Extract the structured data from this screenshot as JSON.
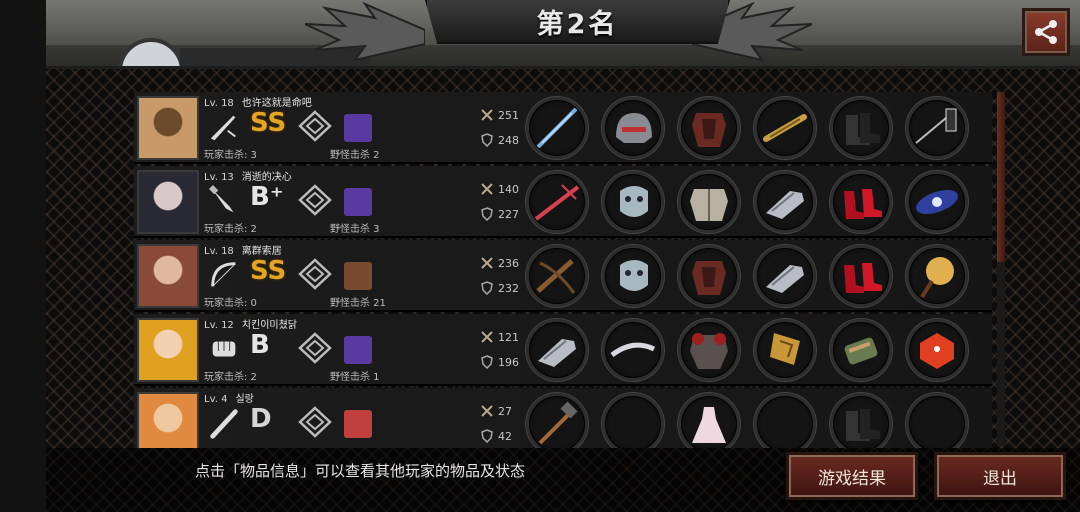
{
  "header": {
    "rank_title": "第2名"
  },
  "players": [
    {
      "level": "Lv. 18",
      "name": "也许这就是命吧",
      "weapon_icon": "dagger-icon",
      "grade": "SS",
      "player_kills": "玩家击杀: 3",
      "monster_kills": "野怪击杀 2",
      "attack": "251",
      "defense": "248",
      "items": [
        "sword-icon",
        "helmet-icon",
        "armor-icon",
        "arm-guard-icon",
        "boots-icon",
        "spear-icon"
      ]
    },
    {
      "level": "Lv. 13",
      "name": "消逝的决心",
      "weapon_icon": "knife-icon",
      "grade": "B⁺",
      "player_kills": "玩家击杀: 2",
      "monster_kills": "野怪击杀 3",
      "attack": "140",
      "defense": "227",
      "items": [
        "crossbow-sword-icon",
        "mask-icon",
        "chest-armor-icon",
        "gauntlet-icon",
        "high-heels-icon",
        "galaxy-icon"
      ]
    },
    {
      "level": "Lv. 18",
      "name": "离群索居",
      "weapon_icon": "bow-icon",
      "grade": "SS",
      "player_kills": "玩家击杀: 0",
      "monster_kills": "野怪击杀 21",
      "attack": "236",
      "defense": "232",
      "items": [
        "crossbow-icon",
        "mask-icon",
        "armor-icon",
        "gauntlet-icon",
        "high-heels-icon",
        "medal-icon"
      ]
    },
    {
      "level": "Lv. 12",
      "name": "치킨이미쳤닭",
      "weapon_icon": "fist-icon",
      "grade": "B",
      "player_kills": "玩家击杀: 2",
      "monster_kills": "野怪击杀 1",
      "attack": "121",
      "defense": "196",
      "items": [
        "gauntlet-icon",
        "headband-icon",
        "heavy-armor-icon",
        "shield-icon",
        "bracer-icon",
        "dice-icon"
      ]
    },
    {
      "level": "Lv. 4",
      "name": "실랑",
      "weapon_icon": "bat-icon",
      "grade": "D",
      "player_kills": "",
      "monster_kills": "",
      "attack": "27",
      "defense": "42",
      "items": [
        "hammer-icon",
        "",
        "dress-icon",
        "",
        "boots-icon",
        ""
      ]
    }
  ],
  "footer": {
    "hint": "点击「物品信息」可以查看其他玩家的物品及状态",
    "result_button": "游戏结果",
    "exit_button": "退出"
  },
  "colors": {
    "grade_ss": "#e4a424",
    "button_red": "#6a2a20",
    "scroll_thumb": "#6a3020"
  }
}
